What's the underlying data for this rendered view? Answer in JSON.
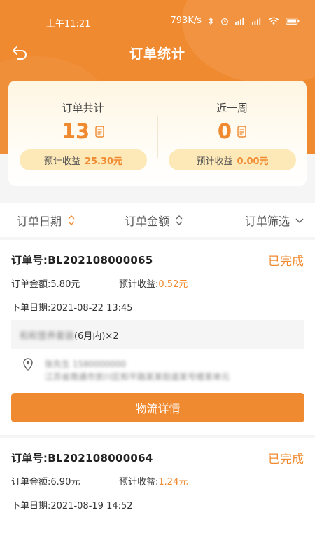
{
  "status_bar": {
    "time": "上午11:21",
    "network_speed": "793K/s"
  },
  "header": {
    "title": "订单统计",
    "back_icon": "back-arrow-icon"
  },
  "stats": {
    "total": {
      "label": "订单共计",
      "value": "13",
      "profit_label": "预计收益",
      "profit_value": "25.30元"
    },
    "week": {
      "label": "近一周",
      "value": "0",
      "profit_label": "预计收益",
      "profit_value": "0.00元"
    }
  },
  "filters": {
    "date": "订单日期",
    "amount": "订单金额",
    "filter": "订单筛选"
  },
  "orders": [
    {
      "order_no_label": "订单号:",
      "order_no": "BL202108000065",
      "status": "已完成",
      "amount_label": "订单金额:",
      "amount": "5.80元",
      "profit_label": "预计收益:",
      "profit": "0.52元",
      "date_label": "下单日期:",
      "date": "2021-08-22 13:45",
      "item_name_blurred": "和和营养套装",
      "item_suffix": "(6月内)×2",
      "address_line1_blurred": "张先生 1580000000",
      "address_line2_blurred": "江苏省南通市崇川区和平路某某街道某号楼某单元",
      "button": "物流详情"
    },
    {
      "order_no_label": "订单号:",
      "order_no": "BL202108000064",
      "status": "已完成",
      "amount_label": "订单金额:",
      "amount": "6.90元",
      "profit_label": "预计收益:",
      "profit": "1.24元",
      "date_label": "下单日期:",
      "date": "2021-08-19 14:52"
    }
  ],
  "colors": {
    "accent": "#f08a30",
    "pill": "#fde9b8"
  }
}
